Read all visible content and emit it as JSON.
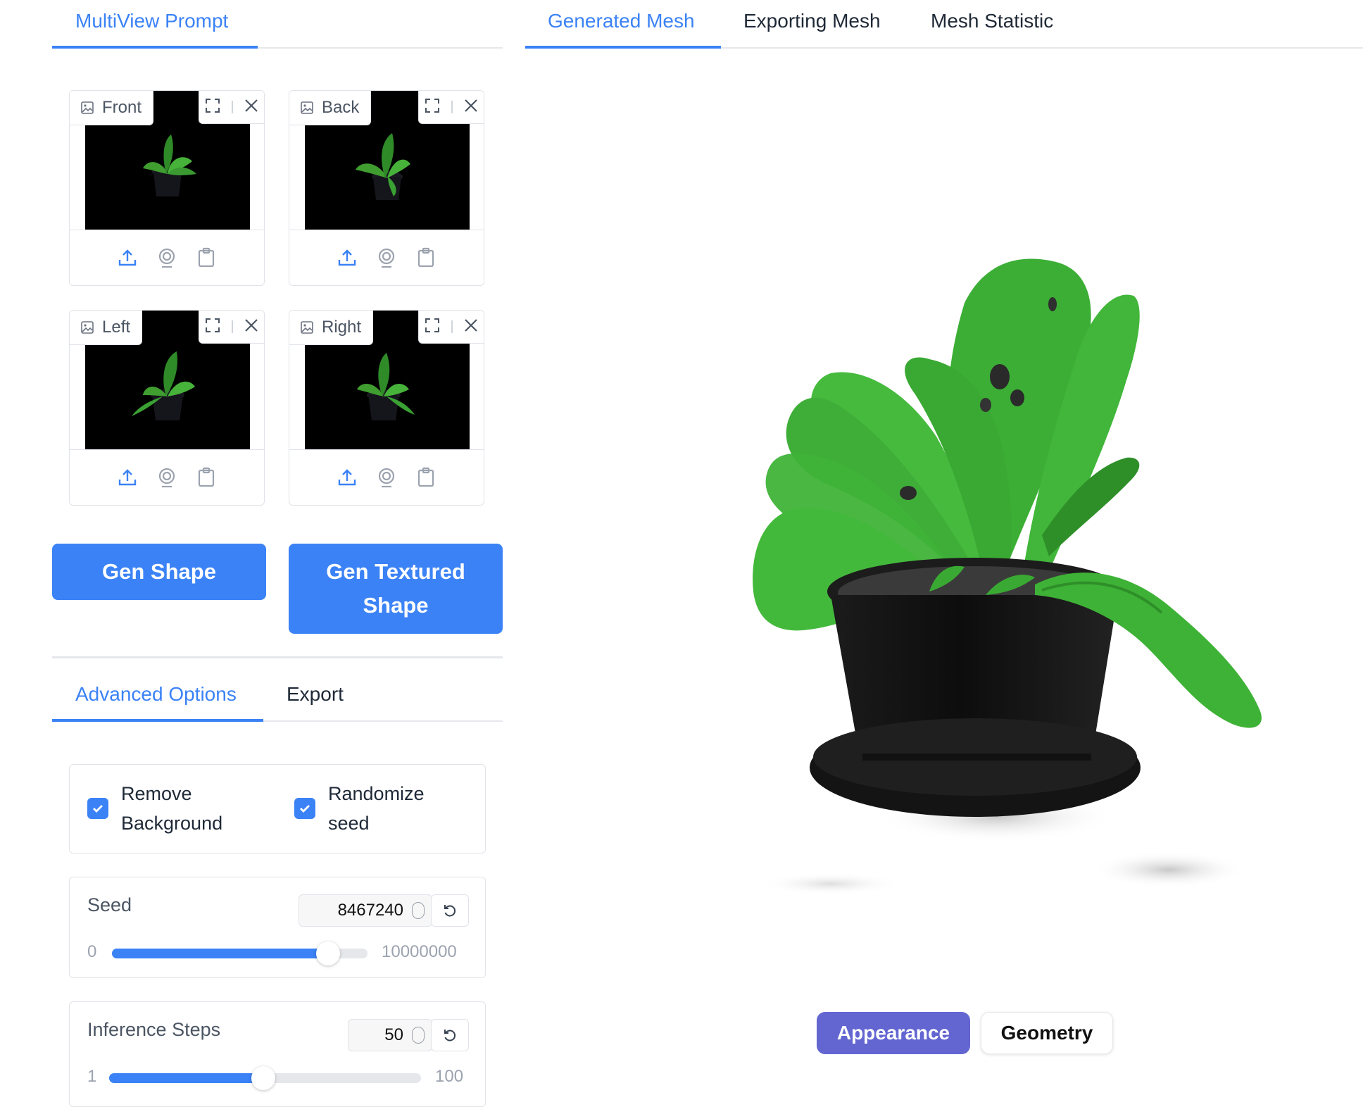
{
  "left_tabs": [
    {
      "label": "MultiView Prompt",
      "active": true
    }
  ],
  "right_tabs": [
    {
      "label": "Generated Mesh",
      "active": true
    },
    {
      "label": "Exporting Mesh",
      "active": false
    },
    {
      "label": "Mesh Statistic",
      "active": false
    }
  ],
  "views": [
    {
      "label": "Front"
    },
    {
      "label": "Back"
    },
    {
      "label": "Left"
    },
    {
      "label": "Right"
    }
  ],
  "buttons": {
    "gen_shape": "Gen Shape",
    "gen_textured_line1": "Gen Textured",
    "gen_textured_line2": "Shape"
  },
  "options_tabs": [
    {
      "label": "Advanced Options",
      "active": true
    },
    {
      "label": "Export",
      "active": false
    }
  ],
  "checkboxes": [
    {
      "line1": "Remove",
      "line2": "Background",
      "checked": true
    },
    {
      "line1": "Randomize",
      "line2": "seed",
      "checked": true
    }
  ],
  "seed": {
    "label": "Seed",
    "value": "8467240",
    "min": "0",
    "max": "10000000",
    "fraction": 0.8467
  },
  "steps": {
    "label": "Inference Steps",
    "value": "50",
    "min": "1",
    "max": "100",
    "fraction": 0.495
  },
  "viewer_modes": [
    {
      "label": "Appearance",
      "active": true
    },
    {
      "label": "Geometry",
      "active": false
    }
  ],
  "colors": {
    "accent": "#3b82f6",
    "segment_active": "#6366d1",
    "leaf": "#3aaa35",
    "pot": "#111111"
  }
}
